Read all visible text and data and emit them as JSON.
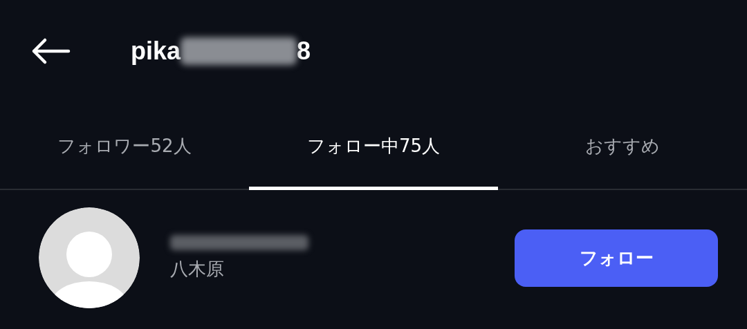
{
  "header": {
    "title_visible_start": "pika",
    "title_visible_end": "8"
  },
  "tabs": [
    {
      "label": "フォロワー52人",
      "selected": false
    },
    {
      "label": "フォロー中75人",
      "selected": true
    },
    {
      "label": "おすすめ",
      "selected": false
    }
  ],
  "users": [
    {
      "name": "八木原",
      "button": "フォロー"
    }
  ]
}
